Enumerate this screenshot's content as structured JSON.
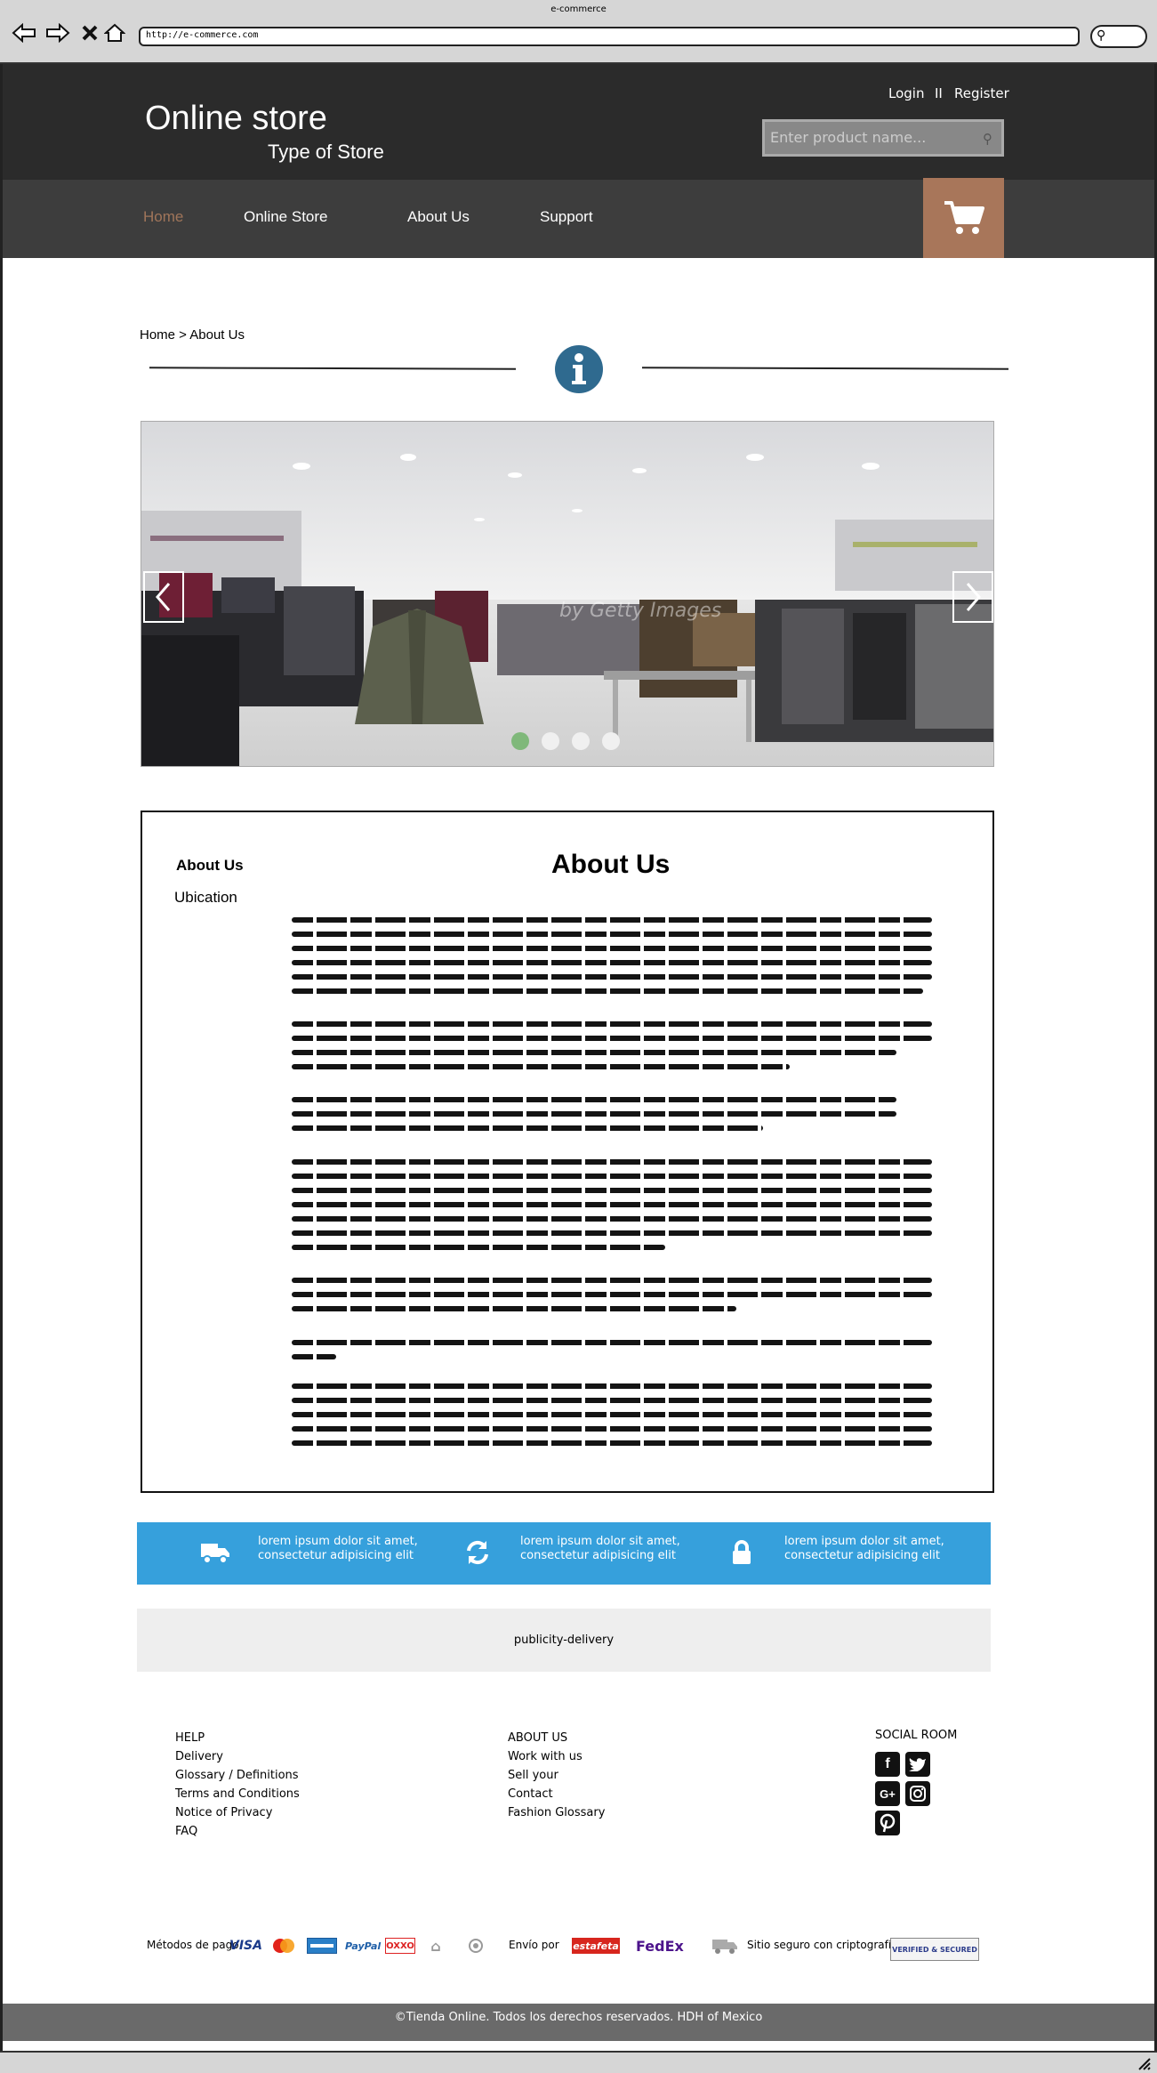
{
  "browser": {
    "tab_title": "e-commerce",
    "url": "http://e-commerce.com"
  },
  "header": {
    "store_name": "Online store",
    "store_type": "Type of Store",
    "login": "Login",
    "separator": "II",
    "register": "Register",
    "search_placeholder": "Enter product name..."
  },
  "menu": {
    "items": [
      {
        "label": "Home",
        "active": true
      },
      {
        "label": "Online Store"
      },
      {
        "label": "About Us"
      },
      {
        "label": "Support"
      }
    ]
  },
  "breadcrumb": "Home > About Us",
  "slider": {
    "watermark": "by Getty Images",
    "dots": 4,
    "active_dot": 1
  },
  "about": {
    "sidebar": [
      "About Us",
      "Ubication"
    ],
    "title": "About Us"
  },
  "features": [
    {
      "icon": "truck-icon",
      "text": "lorem ipsum dolor sit amet, consectetur adipisicing elit"
    },
    {
      "icon": "refresh-icon",
      "text": "lorem ipsum dolor sit amet, consectetur adipisicing elit"
    },
    {
      "icon": "lock-icon",
      "text": "lorem ipsum dolor sit amet, consectetur adipisicing elit"
    }
  ],
  "publicity": "publicity-delivery",
  "footer": {
    "help": {
      "title": "HELP",
      "links": [
        "Delivery",
        "Glossary / Definitions",
        "Terms and Conditions",
        "Notice of Privacy",
        "FAQ"
      ]
    },
    "about": {
      "title": "ABOUT US",
      "links": [
        "Work with us",
        "Sell your",
        "Contact",
        "Fashion Glossary"
      ]
    },
    "social": {
      "title": "SOCIAL ROOM",
      "icons": [
        "facebook-icon",
        "twitter-icon",
        "google-plus-icon",
        "instagram-icon",
        "pinterest-icon"
      ]
    }
  },
  "payments": {
    "label": "Métodos de pago",
    "cards": [
      "VISA",
      "PayPal",
      "OXXO"
    ],
    "shipping_label": "Envío por",
    "carriers": [
      "estafeta",
      "FedEx"
    ],
    "ssl_label": "Sitio seguro con criptografía SSL",
    "ssl_badge": "VERIFIED & SECURED"
  },
  "copyright": "©Tienda Online. Todos los derechos reservados. HDH of Mexico",
  "colors": {
    "header_bg": "#2b2b2b",
    "menu_bg": "#3d3d3d",
    "accent_brown": "#a8765a",
    "info_blue": "#2f6a8f",
    "features_blue": "#36a0dc"
  }
}
